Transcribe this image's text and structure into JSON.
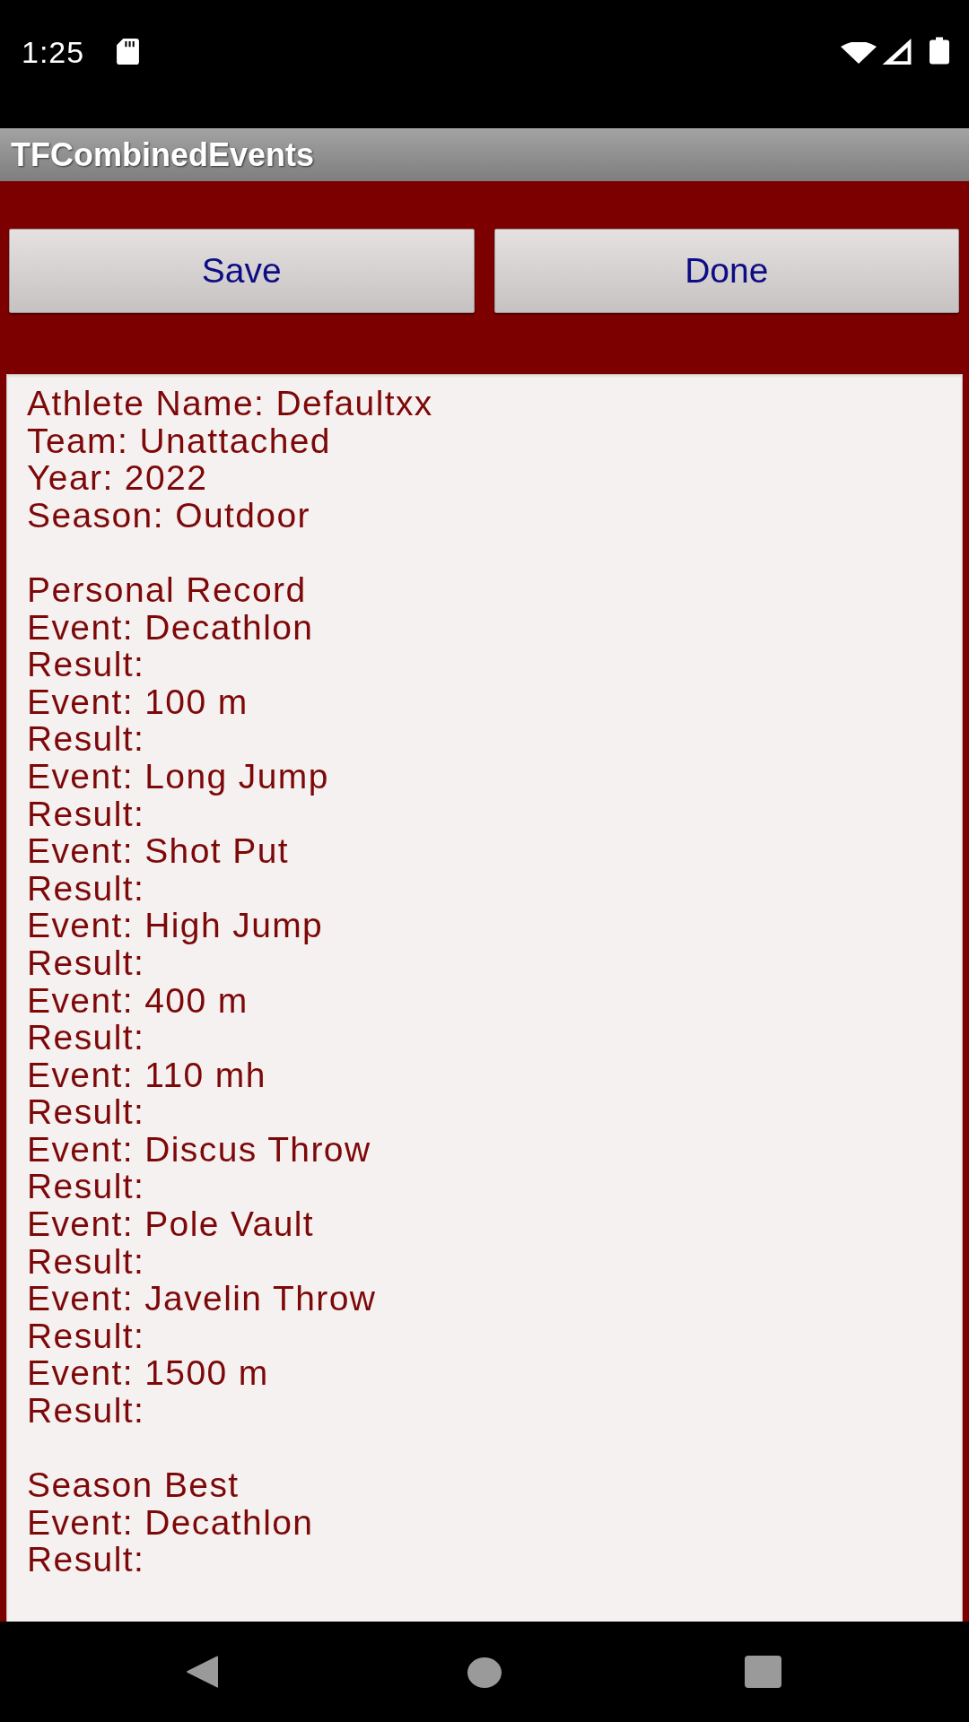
{
  "status_bar": {
    "time": "1:25"
  },
  "app_bar": {
    "title": "TFCombinedEvents"
  },
  "buttons": [
    {
      "label": "Save"
    },
    {
      "label": "Done"
    }
  ],
  "details": {
    "athlete": [
      "Athlete Name: Defaultxx",
      "Team: Unattached",
      "Year: 2022",
      "Season: Outdoor"
    ],
    "sections": [
      {
        "heading": "Personal Record",
        "entries": [
          {
            "event": "Event: Decathlon",
            "result": "Result:"
          },
          {
            "event": "Event: 100 m",
            "result": "Result:"
          },
          {
            "event": "Event: Long Jump",
            "result": "Result:"
          },
          {
            "event": "Event: Shot Put",
            "result": "Result:"
          },
          {
            "event": "Event: High Jump",
            "result": "Result:"
          },
          {
            "event": "Event: 400 m",
            "result": "Result:"
          },
          {
            "event": "Event: 110 mh",
            "result": "Result:"
          },
          {
            "event": "Event: Discus Throw",
            "result": "Result:"
          },
          {
            "event": "Event: Pole Vault",
            "result": "Result:"
          },
          {
            "event": "Event: Javelin Throw",
            "result": "Result:"
          },
          {
            "event": "Event: 1500 m",
            "result": "Result:"
          }
        ]
      },
      {
        "heading": "Season Best",
        "entries": [
          {
            "event": "Event: Decathlon",
            "result": "Result:"
          }
        ]
      }
    ]
  }
}
